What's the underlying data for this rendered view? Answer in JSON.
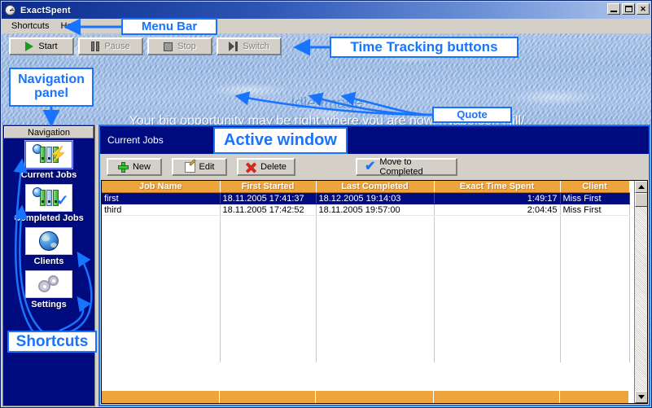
{
  "window": {
    "title": "ExactSpent",
    "icon": "stopwatch-icon",
    "minimize": "minimize-icon",
    "maximize": "maximize-icon",
    "close": "close-icon"
  },
  "menubar": {
    "items": [
      {
        "label": "Shortcuts"
      },
      {
        "label": "Help"
      }
    ]
  },
  "time_tracking": {
    "buttons": [
      {
        "label": "Start",
        "icon": "play-icon",
        "enabled": true
      },
      {
        "label": "Pause",
        "icon": "pause-icon",
        "enabled": false
      },
      {
        "label": "Stop",
        "icon": "stop-icon",
        "enabled": false
      },
      {
        "label": "Switch",
        "icon": "switch-icon",
        "enabled": false
      }
    ]
  },
  "idle_image": {
    "heading": "Idle Image",
    "quote": "Your big opportunity may be right where you are now. /Napoleon Hill/"
  },
  "annotations": [
    {
      "id": "menu-bar",
      "label": "Menu Bar"
    },
    {
      "id": "time-tracking-buttons",
      "label": "Time Tracking buttons"
    },
    {
      "id": "navigation-panel",
      "label": "Navigation panel"
    },
    {
      "id": "quote",
      "label": "Quote"
    },
    {
      "id": "shortcuts",
      "label": "Shortcuts"
    },
    {
      "id": "active-window",
      "label": "Active window"
    }
  ],
  "navigation": {
    "header": "Navigation",
    "items": [
      {
        "label": "Current Jobs",
        "icon": "binders-bolt-icon",
        "selected": true
      },
      {
        "label": "Completed Jobs",
        "icon": "binders-check-icon",
        "selected": false
      },
      {
        "label": "Clients",
        "icon": "globe-icon",
        "selected": false
      },
      {
        "label": "Settings",
        "icon": "gears-icon",
        "selected": false
      }
    ]
  },
  "main": {
    "title": "Current Jobs",
    "toolbar": [
      {
        "label": "New",
        "icon": "plus-icon"
      },
      {
        "label": "Edit",
        "icon": "pencil-icon"
      },
      {
        "label": "Delete",
        "icon": "x-icon"
      },
      {
        "label": "Move to Completed",
        "icon": "check-icon"
      }
    ],
    "grid": {
      "columns": [
        "Job Name",
        "First Started",
        "Last Completed",
        "Exact Time Spent",
        "Client"
      ],
      "rows": [
        {
          "selected": true,
          "cells": [
            "first",
            "18.11.2005 17:41:37",
            "18.12.2005 19:14:03",
            "1:49:17",
            "Miss First"
          ]
        },
        {
          "selected": false,
          "cells": [
            "third",
            "18.11.2005 17:42:52",
            "18.11.2005 19:57:00",
            "2:04:45",
            "Miss First"
          ]
        }
      ],
      "scrollbar": {
        "up": "scroll-up-icon",
        "down": "scroll-down-icon"
      }
    }
  },
  "colors": {
    "annotation_blue": "#1874ff",
    "header_orange": "#eda43c",
    "selection_navy": "#000b80",
    "title_navy": "#0a2a8e",
    "chrome_gray": "#d4d0c8"
  }
}
